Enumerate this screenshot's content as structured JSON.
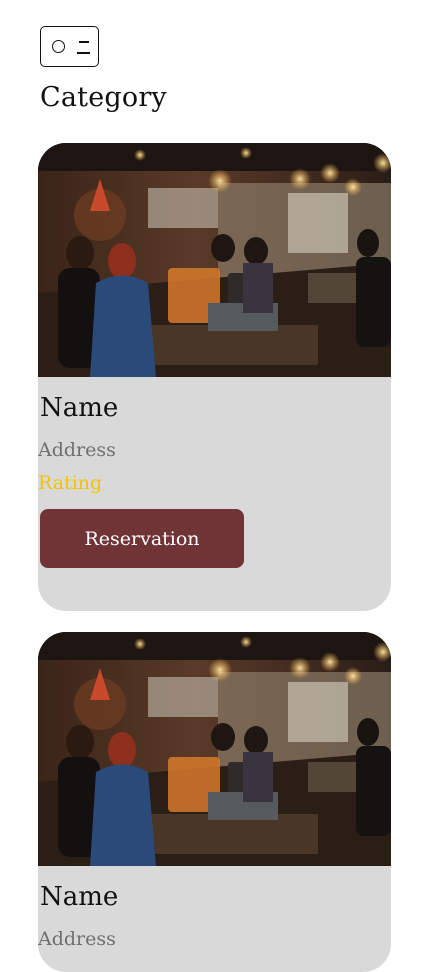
{
  "header": {
    "menu_icon": "toggle-menu-icon",
    "title": "Category"
  },
  "cards": [
    {
      "image": "restaurant-bar-photo",
      "name": "Name",
      "address": "Address",
      "rating": "Rating",
      "button_label": "Reservation"
    },
    {
      "image": "restaurant-bar-photo",
      "name": "Name",
      "address": "Address"
    }
  ],
  "colors": {
    "card_background": "#d9d9d9",
    "button_background": "#713436",
    "rating_text": "#f2c300",
    "address_text": "#6f6f6f"
  }
}
